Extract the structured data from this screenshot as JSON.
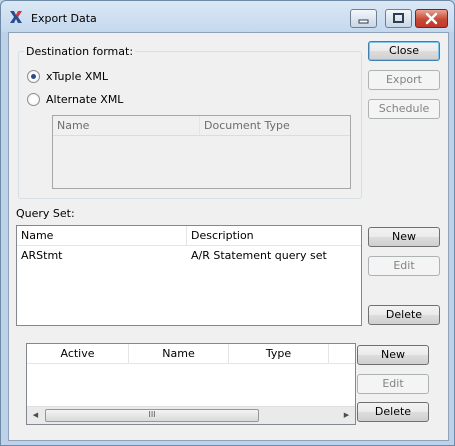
{
  "window": {
    "title": "Export Data",
    "icon": "x-logo-icon"
  },
  "destination": {
    "label": "Destination format:",
    "options": [
      {
        "label": "xTuple XML",
        "checked": true
      },
      {
        "label": "Alternate XML",
        "checked": false
      }
    ],
    "columns": [
      "Name",
      "Document Type"
    ]
  },
  "buttons": {
    "close": "Close",
    "export": "Export",
    "schedule": "Schedule"
  },
  "query_set": {
    "label": "Query Set:",
    "columns": [
      "Name",
      "Description"
    ],
    "rows": [
      {
        "name": "ARStmt",
        "description": "A/R Statement query set"
      }
    ],
    "new": "New",
    "edit": "Edit",
    "delete": "Delete"
  },
  "items": {
    "columns": [
      "Active",
      "Name",
      "Type"
    ],
    "new": "New",
    "edit": "Edit",
    "delete": "Delete",
    "scroll_grip": "III"
  }
}
